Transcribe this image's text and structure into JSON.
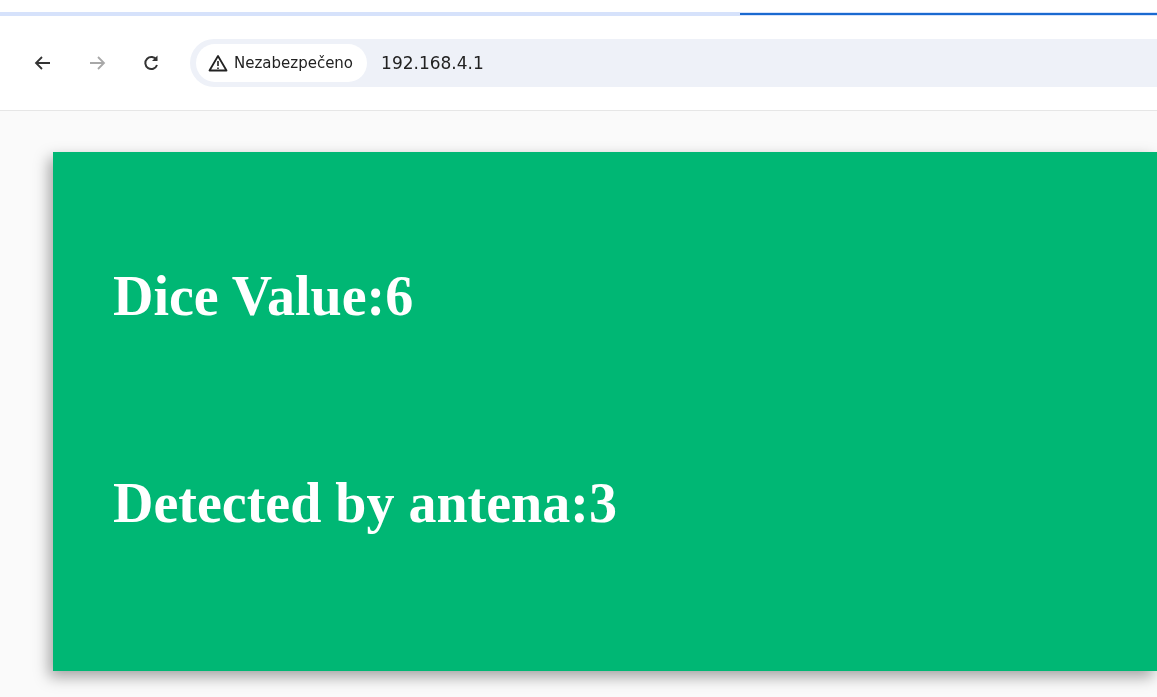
{
  "toolbar": {
    "back": {
      "disabled": false
    },
    "forward": {
      "disabled": true
    },
    "security_chip": "Nezabezpečeno",
    "address": "192.168.4.1"
  },
  "card": {
    "lines": [
      "Dice Value:6",
      "Detected by antena:3"
    ]
  }
}
